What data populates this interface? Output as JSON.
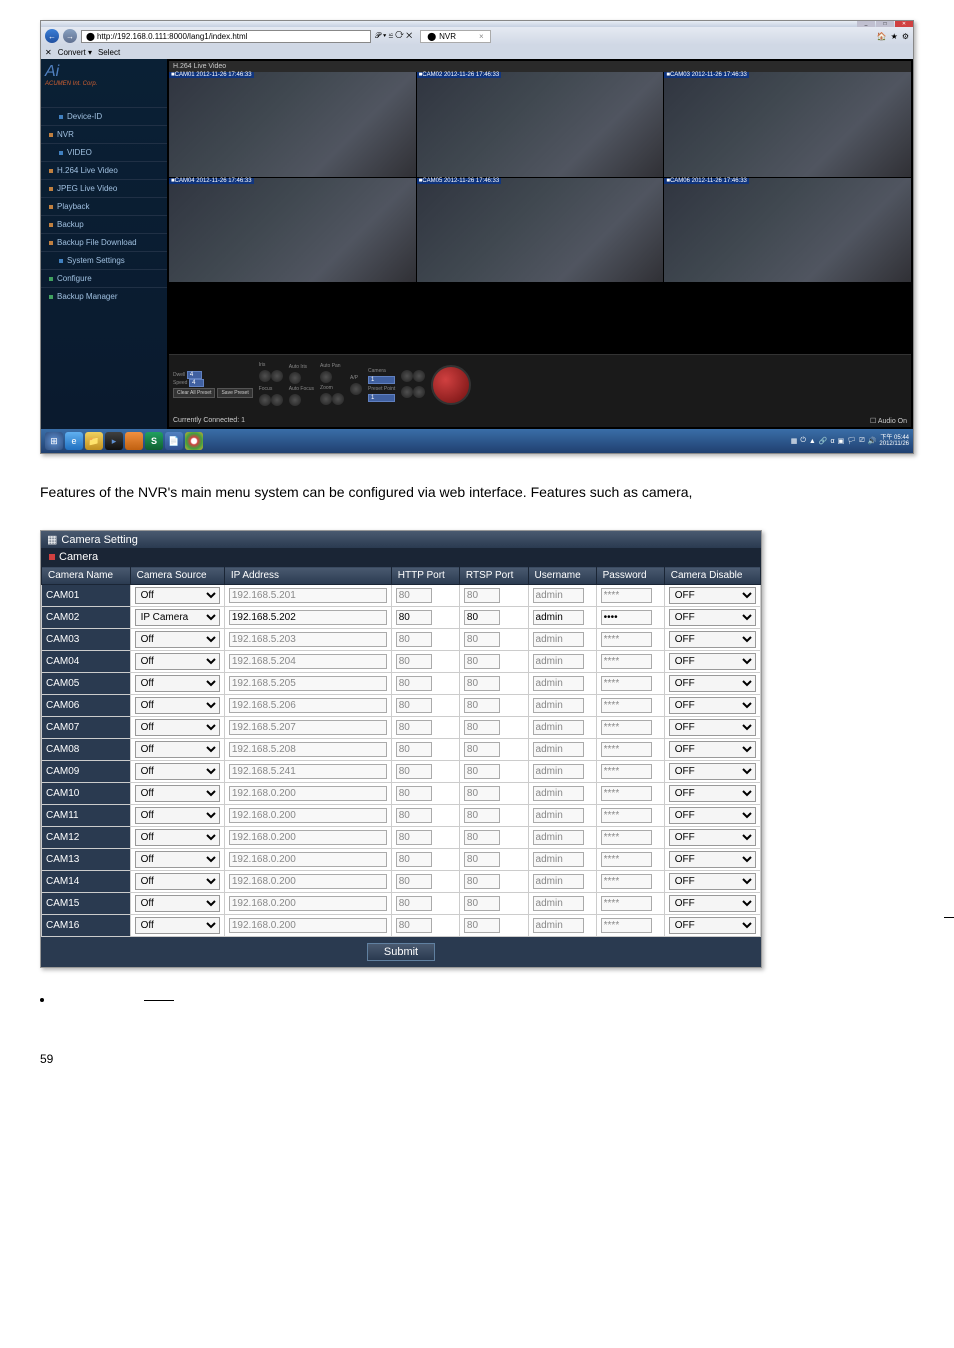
{
  "browser": {
    "url": "http://192.168.0.111:8000/lang1/index.html",
    "url_suffix": "𝒫 ▾ ≌ ⟳ ✕",
    "tab_icon": "⬤",
    "tab_title": "NVR",
    "fav_bar": {
      "convert": "Convert ▾",
      "select": "Select"
    }
  },
  "sidebar": {
    "brand": "Ai",
    "brand_sub": "ACUMEN Int. Corp.",
    "items": [
      {
        "label": "Device-ID",
        "dot": "blue",
        "sub": true
      },
      {
        "label": "NVR",
        "dot": "orange",
        "sub": false
      },
      {
        "label": "VIDEO",
        "dot": "blue",
        "sub": true
      },
      {
        "label": "H.264 Live Video",
        "dot": "orange",
        "sub": false
      },
      {
        "label": "JPEG Live Video",
        "dot": "orange",
        "sub": false
      },
      {
        "label": "Playback",
        "dot": "orange",
        "sub": false
      },
      {
        "label": "Backup",
        "dot": "orange",
        "sub": false
      },
      {
        "label": "Backup File Download",
        "dot": "orange",
        "sub": false
      },
      {
        "label": "System Settings",
        "dot": "blue",
        "sub": true
      },
      {
        "label": "Configure",
        "dot": "green",
        "sub": false
      },
      {
        "label": "Backup Manager",
        "dot": "green",
        "sub": false
      }
    ]
  },
  "video": {
    "title": "H.264 Live Video",
    "cells": [
      "CAM01 2012-11-26 17:46:33",
      "CAM02 2012-11-26 17:46:33",
      "CAM03 2012-11-26 17:46:33",
      "CAM04 2012-11-26 17:46:33",
      "CAM05 2012-11-26 17:46:33",
      "CAM06 2012-11-26 17:46:33"
    ]
  },
  "controls": {
    "dwell_label": "Dwell",
    "dwell_value": "4",
    "speed_label": "Speed",
    "speed_value": "4",
    "buttons": {
      "clear": "Clear All Preset",
      "save": "Save Preset"
    },
    "labels": {
      "iris": "Iris",
      "autoiris": "Auto Iris",
      "autopan": "Auto Pan",
      "focus": "Focus",
      "autofocus": "Auto Focus",
      "zoom": "Zoom",
      "ap": "A/P",
      "camera": "Camera",
      "preset": "Preset Point"
    },
    "camera_sel": "1",
    "preset_sel": "1",
    "status": "Currently Connected: 1",
    "audio": "Audio On"
  },
  "taskbar": {
    "clock_time": "下午 05:44",
    "clock_date": "2012/11/26"
  },
  "body_text": "Features of the NVR's main menu system can be configured via web interface.  Features such as camera,",
  "camera_setting": {
    "title": "Camera Setting",
    "subtitle": "Camera",
    "headers": [
      "Camera Name",
      "Camera Source",
      "IP Address",
      "HTTP Port",
      "RTSP Port",
      "Username",
      "Password",
      "Camera Disable"
    ],
    "rows": [
      {
        "name": "CAM01",
        "source": "Off",
        "ip": "192.168.5.201",
        "http": "80",
        "rtsp": "80",
        "user": "admin",
        "pw": "****",
        "disable": "OFF",
        "active": false
      },
      {
        "name": "CAM02",
        "source": "IP Camera",
        "ip": "192.168.5.202",
        "http": "80",
        "rtsp": "80",
        "user": "admin",
        "pw": "••••",
        "disable": "OFF",
        "active": true
      },
      {
        "name": "CAM03",
        "source": "Off",
        "ip": "192.168.5.203",
        "http": "80",
        "rtsp": "80",
        "user": "admin",
        "pw": "****",
        "disable": "OFF",
        "active": false
      },
      {
        "name": "CAM04",
        "source": "Off",
        "ip": "192.168.5.204",
        "http": "80",
        "rtsp": "80",
        "user": "admin",
        "pw": "****",
        "disable": "OFF",
        "active": false
      },
      {
        "name": "CAM05",
        "source": "Off",
        "ip": "192.168.5.205",
        "http": "80",
        "rtsp": "80",
        "user": "admin",
        "pw": "****",
        "disable": "OFF",
        "active": false
      },
      {
        "name": "CAM06",
        "source": "Off",
        "ip": "192.168.5.206",
        "http": "80",
        "rtsp": "80",
        "user": "admin",
        "pw": "****",
        "disable": "OFF",
        "active": false
      },
      {
        "name": "CAM07",
        "source": "Off",
        "ip": "192.168.5.207",
        "http": "80",
        "rtsp": "80",
        "user": "admin",
        "pw": "****",
        "disable": "OFF",
        "active": false
      },
      {
        "name": "CAM08",
        "source": "Off",
        "ip": "192.168.5.208",
        "http": "80",
        "rtsp": "80",
        "user": "admin",
        "pw": "****",
        "disable": "OFF",
        "active": false
      },
      {
        "name": "CAM09",
        "source": "Off",
        "ip": "192.168.5.241",
        "http": "80",
        "rtsp": "80",
        "user": "admin",
        "pw": "****",
        "disable": "OFF",
        "active": false
      },
      {
        "name": "CAM10",
        "source": "Off",
        "ip": "192.168.0.200",
        "http": "80",
        "rtsp": "80",
        "user": "admin",
        "pw": "****",
        "disable": "OFF",
        "active": false
      },
      {
        "name": "CAM11",
        "source": "Off",
        "ip": "192.168.0.200",
        "http": "80",
        "rtsp": "80",
        "user": "admin",
        "pw": "****",
        "disable": "OFF",
        "active": false
      },
      {
        "name": "CAM12",
        "source": "Off",
        "ip": "192.168.0.200",
        "http": "80",
        "rtsp": "80",
        "user": "admin",
        "pw": "****",
        "disable": "OFF",
        "active": false
      },
      {
        "name": "CAM13",
        "source": "Off",
        "ip": "192.168.0.200",
        "http": "80",
        "rtsp": "80",
        "user": "admin",
        "pw": "****",
        "disable": "OFF",
        "active": false
      },
      {
        "name": "CAM14",
        "source": "Off",
        "ip": "192.168.0.200",
        "http": "80",
        "rtsp": "80",
        "user": "admin",
        "pw": "****",
        "disable": "OFF",
        "active": false
      },
      {
        "name": "CAM15",
        "source": "Off",
        "ip": "192.168.0.200",
        "http": "80",
        "rtsp": "80",
        "user": "admin",
        "pw": "****",
        "disable": "OFF",
        "active": false
      },
      {
        "name": "CAM16",
        "source": "Off",
        "ip": "192.168.0.200",
        "http": "80",
        "rtsp": "80",
        "user": "admin",
        "pw": "****",
        "disable": "OFF",
        "active": false
      }
    ],
    "submit": "Submit"
  },
  "page_number": "59"
}
